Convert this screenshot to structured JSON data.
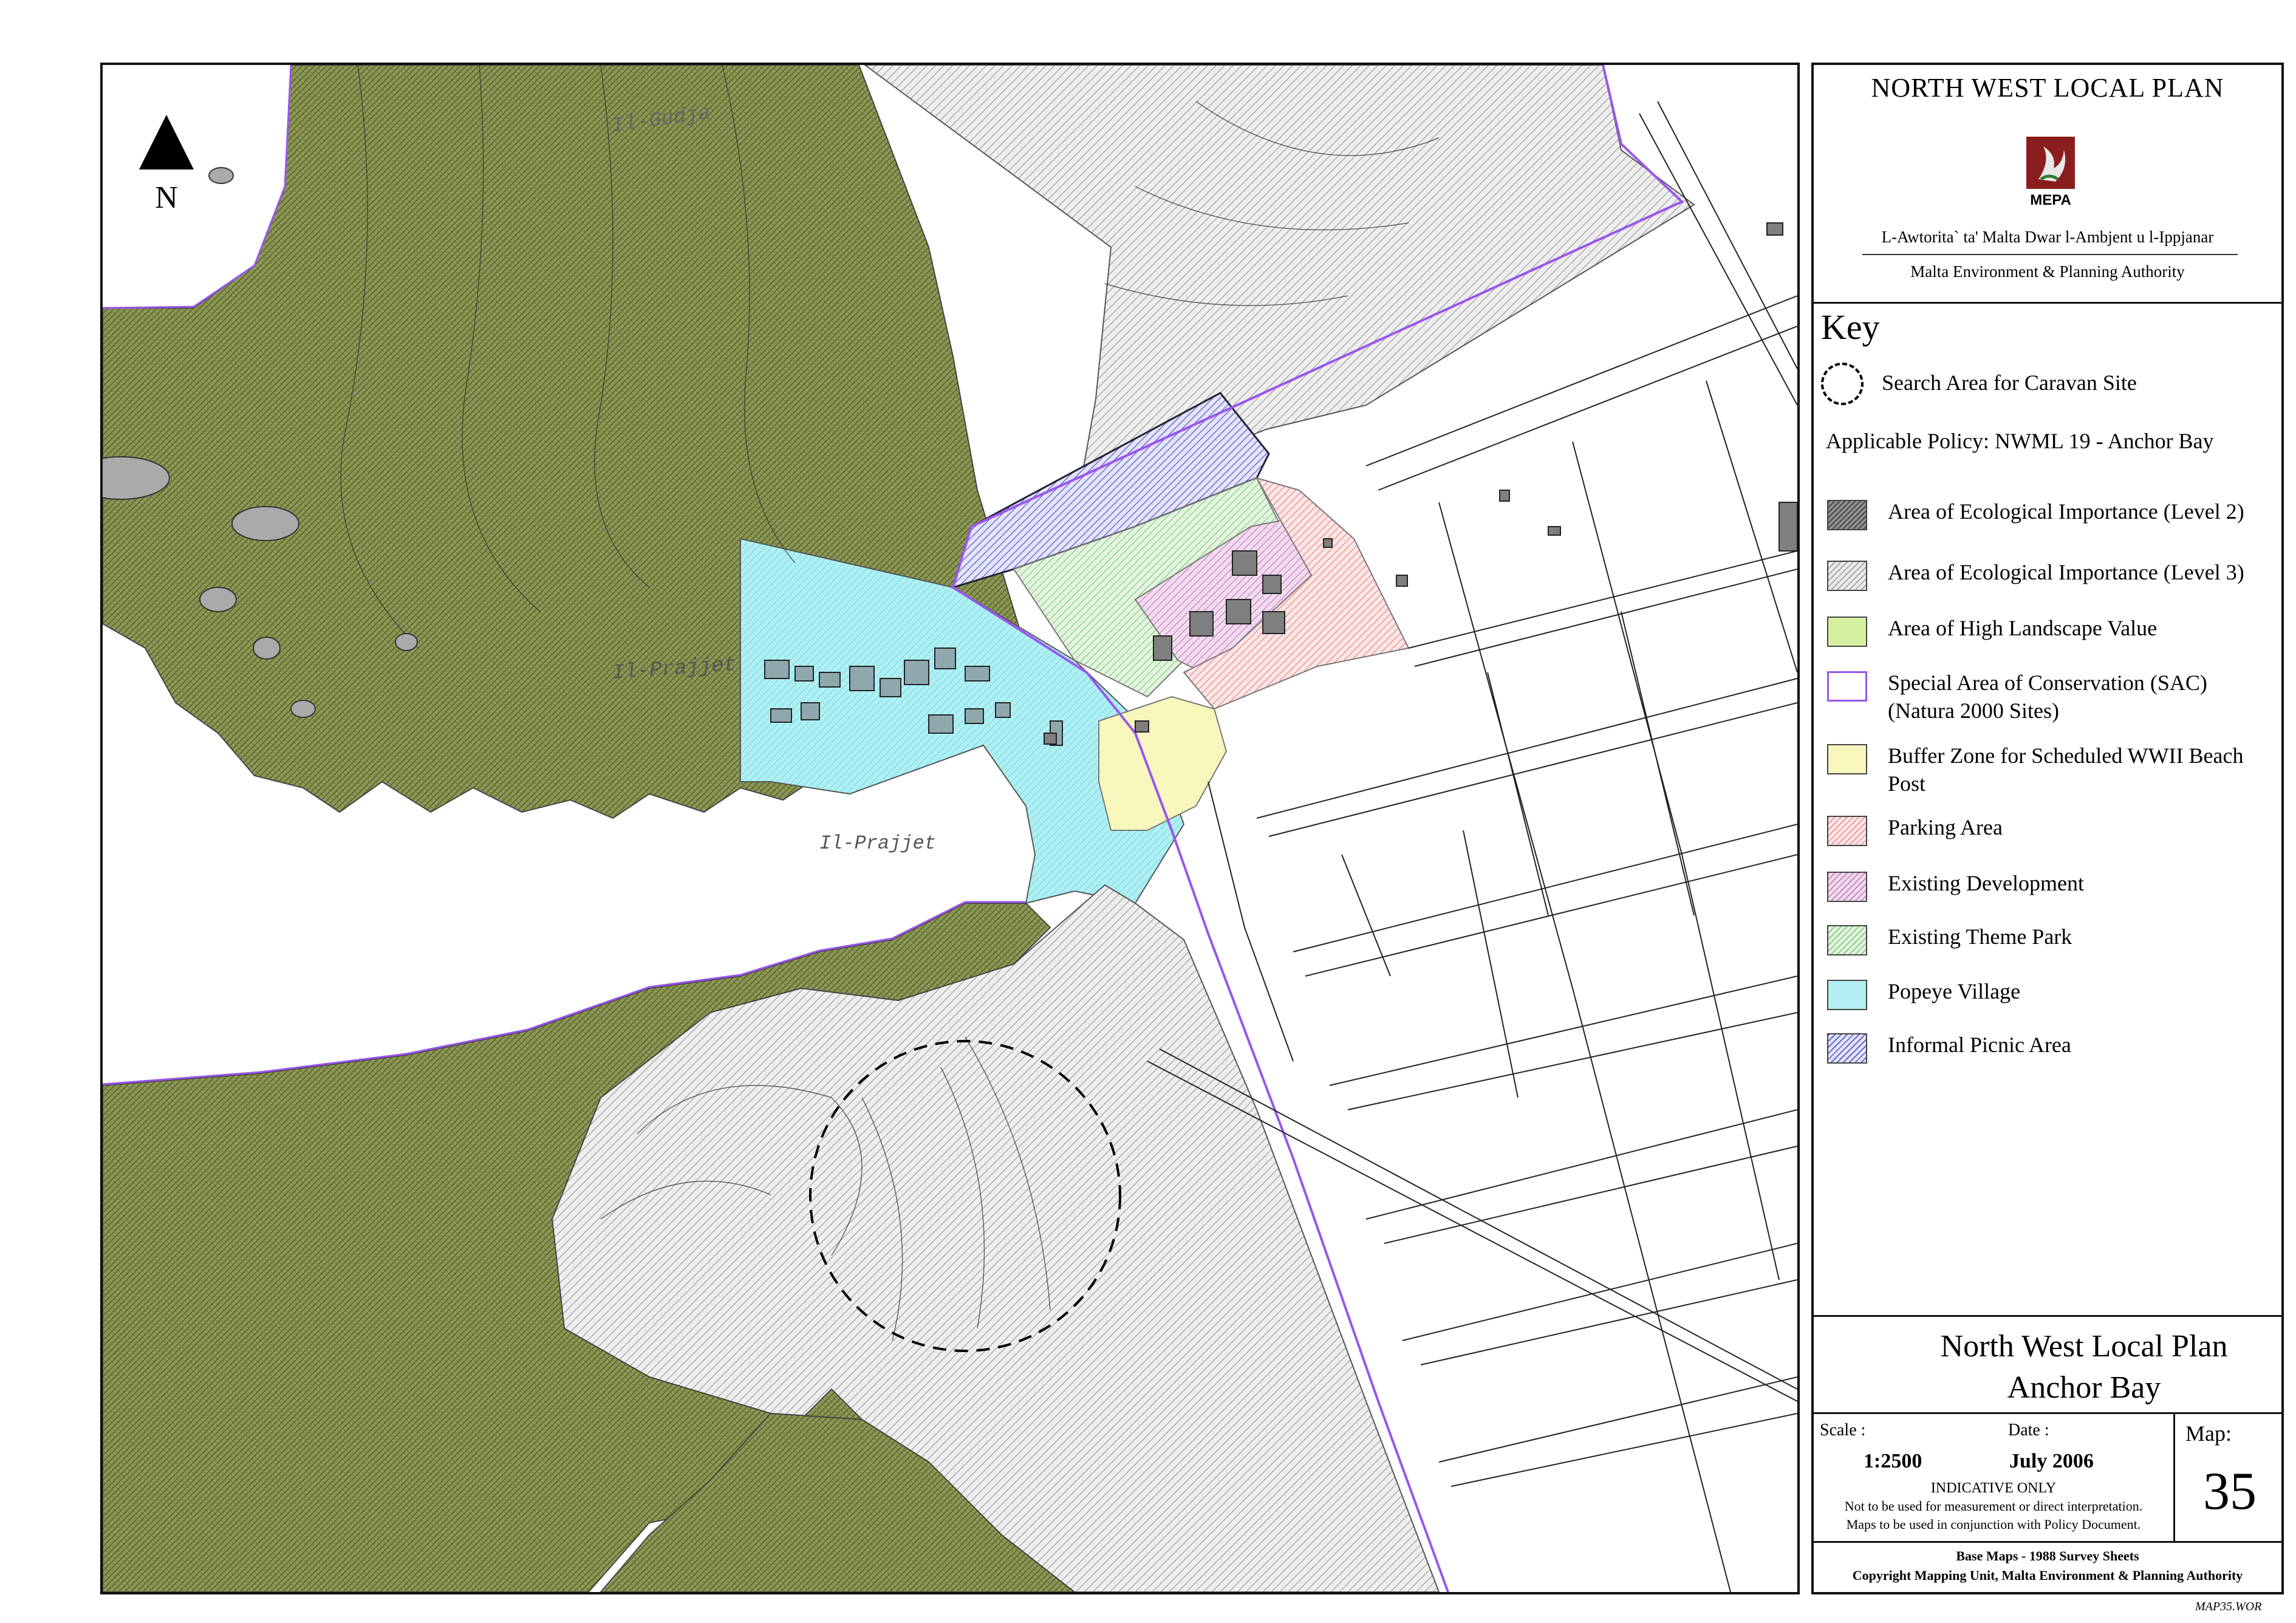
{
  "map": {
    "place_labels": [
      "Il-Gudja",
      "Il-Prajjet",
      "Il-Prajjet"
    ],
    "north_label": "N"
  },
  "panel": {
    "title": "NORTH WEST LOCAL PLAN",
    "logo_text": "MEPA",
    "authority_mt": "L-Awtorita` ta' Malta Dwar l-Ambjent u l-Ippjanar",
    "authority_en": "Malta Environment & Planning Authority",
    "key_heading": "Key",
    "search_area_label": "Search Area for Caravan Site",
    "policy_text": "Applicable Policy: NWML 19 - Anchor Bay",
    "legend": [
      {
        "label": "Area of Ecological Importance (Level 2)",
        "color": "#8c8c8c",
        "pattern": "dense-hatch"
      },
      {
        "label": "Area of Ecological Importance (Level 3)",
        "color": "#d4d4d4",
        "pattern": "light-hatch"
      },
      {
        "label": "Area of High Landscape Value",
        "color": "#d5f0a0",
        "pattern": "solid"
      },
      {
        "label": "Special Area of Conservation (SAC) (Natura 2000 Sites)",
        "color": "#9955ee",
        "pattern": "outline"
      },
      {
        "label": "Buffer Zone for Scheduled WWII Beach Post",
        "color": "#f6f6bd",
        "pattern": "solid"
      },
      {
        "label": "Parking Area",
        "color": "#f4b8b8",
        "pattern": "hatch"
      },
      {
        "label": "Existing Development",
        "color": "#dcb0d8",
        "pattern": "hatch"
      },
      {
        "label": "Existing Theme Park",
        "color": "#bfe0bf",
        "pattern": "hatch"
      },
      {
        "label": "Popeye Village",
        "color": "#b2eef2",
        "pattern": "solid"
      },
      {
        "label": "Informal Picnic Area",
        "color": "#b8b8ee",
        "pattern": "hatch"
      }
    ],
    "title_line1": "North West Local Plan",
    "title_line2": "Anchor Bay",
    "scale_label": "Scale :",
    "scale_value": "1:2500",
    "date_label": "Date :",
    "date_value": "July 2006",
    "indicative": "INDICATIVE ONLY",
    "note_1": "Not to be used for measurement or direct interpretation.",
    "note_2": "Maps to be used in conjunction with Policy Document.",
    "map_label": "Map:",
    "map_number": "35",
    "base_maps": "Base Maps - 1988 Survey Sheets",
    "copyright": "Copyright Mapping Unit, Malta Environment & Planning Authority"
  },
  "file_code": "MAP35.WOR"
}
